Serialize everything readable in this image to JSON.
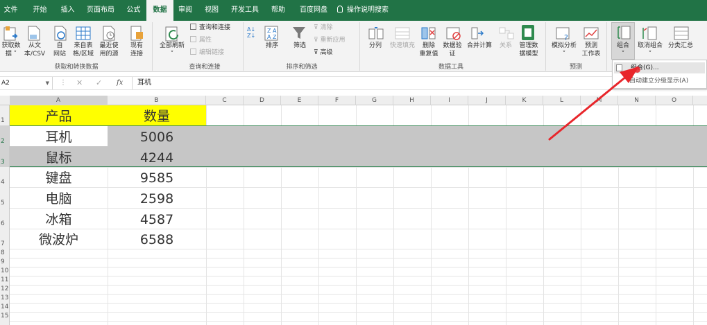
{
  "tabs": [
    "文件",
    "开始",
    "插入",
    "页面布局",
    "公式",
    "数据",
    "审阅",
    "视图",
    "开发工具",
    "帮助",
    "百度网盘"
  ],
  "tell_me": "操作说明搜索",
  "groups": {
    "get_transform": {
      "label": "获取和转换数据",
      "buttons": [
        "获取数\n据",
        "从文\n本/CSV",
        "自\n网站",
        "来自表\n格/区域",
        "最近使\n用的源",
        "现有\n连接"
      ]
    },
    "queries": {
      "label": "查询和连接",
      "refresh": "全部刷新",
      "items": [
        "查询和连接",
        "属性",
        "编辑链接"
      ]
    },
    "sort_filter": {
      "label": "排序和筛选",
      "sort": "排序",
      "filter": "筛选",
      "items": [
        "清除",
        "重新应用",
        "高级"
      ]
    },
    "data_tools": {
      "label": "数据工具",
      "buttons": [
        "分列",
        "快速填充",
        "删除\n重复值",
        "数据验\n证",
        "合并计算",
        "关系",
        "管理数\n据模型"
      ]
    },
    "forecast": {
      "label": "预测",
      "buttons": [
        "模拟分析",
        "预测\n工作表"
      ]
    },
    "outline": {
      "buttons": [
        "组合",
        "取消组合",
        "分类汇总"
      ]
    }
  },
  "dropdown": {
    "items": [
      "组合(G)...",
      "自动建立分级显示(A)"
    ]
  },
  "formula_bar": {
    "name_box": "A2",
    "fx": "fx",
    "value": "耳机"
  },
  "columns": [
    "A",
    "B",
    "C",
    "D",
    "E",
    "F",
    "G",
    "H",
    "I",
    "J",
    "K",
    "L",
    "M",
    "N",
    "O"
  ],
  "rows": [
    "1",
    "2",
    "3",
    "4",
    "5",
    "6",
    "7",
    "8",
    "9",
    "10",
    "11",
    "12",
    "13",
    "14",
    "15"
  ],
  "table": {
    "header": [
      "产品",
      "数量"
    ],
    "data": [
      [
        "耳机",
        "5006"
      ],
      [
        "鼠标",
        "4244"
      ],
      [
        "键盘",
        "9585"
      ],
      [
        "电脑",
        "2598"
      ],
      [
        "冰箱",
        "4587"
      ],
      [
        "微波炉",
        "6588"
      ]
    ]
  },
  "colors": {
    "accent": "#217346",
    "header_fill": "#ffff00",
    "selection": "#c6c6c6",
    "arrow": "#e8262b"
  }
}
